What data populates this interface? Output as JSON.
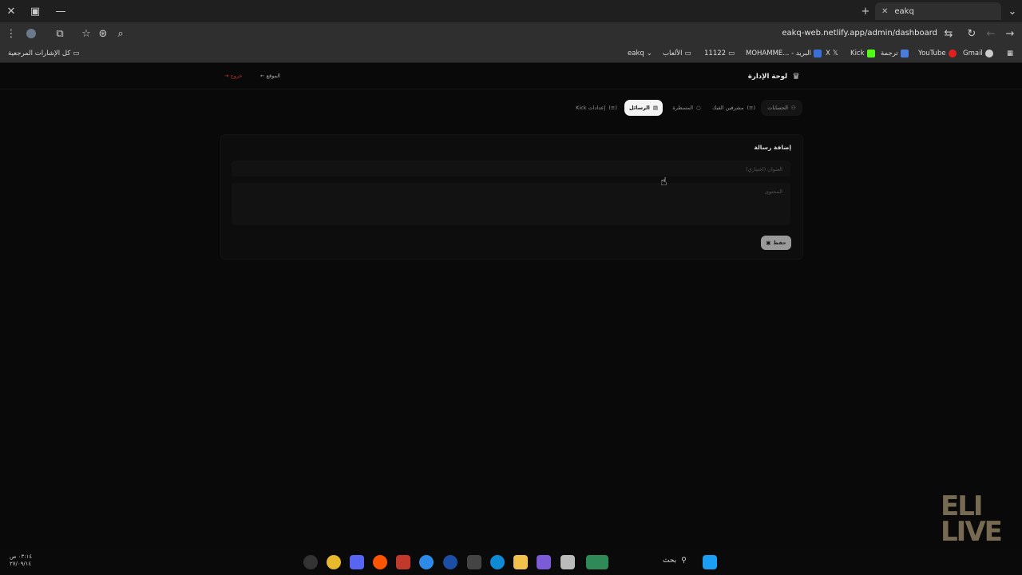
{
  "browser": {
    "tab_title": "eakq",
    "url": "eakq-web.netlify.app/admin/dashboard",
    "bookmarks_folder": "كل الإشارات المرجعية",
    "bookmarks": [
      "eakq",
      "الألعاب",
      "11122",
      "MOHAMME... - البريد",
      "X",
      "Kick",
      "ترجمة",
      "YouTube",
      "Gmail"
    ]
  },
  "header": {
    "title": "لوحة الإدارة",
    "site_link": "← الموقع",
    "logout": "⇥ خروج"
  },
  "nav_tabs": [
    {
      "label": "الحسابات",
      "active": false
    },
    {
      "label": "مشرفين القبك",
      "active": false
    },
    {
      "label": "المسطرة",
      "active": false
    },
    {
      "label": "الرسائل",
      "active": true
    },
    {
      "label": "إعدادات Kick",
      "active": false
    }
  ],
  "form": {
    "title": "إضافة رسالة",
    "title_placeholder": "العنوان (اختياري)",
    "content_placeholder": "المحتوى",
    "save_label": "حفظ"
  },
  "taskbar": {
    "search_label": "بحث",
    "time": "٠٣:١٤ ص",
    "date": "٢٧/٠٩/١٤"
  },
  "watermark": "ELITE LIVE",
  "colors": {
    "accent_logout": "#b33333",
    "active_tab_bg": "#f4f4f4"
  }
}
